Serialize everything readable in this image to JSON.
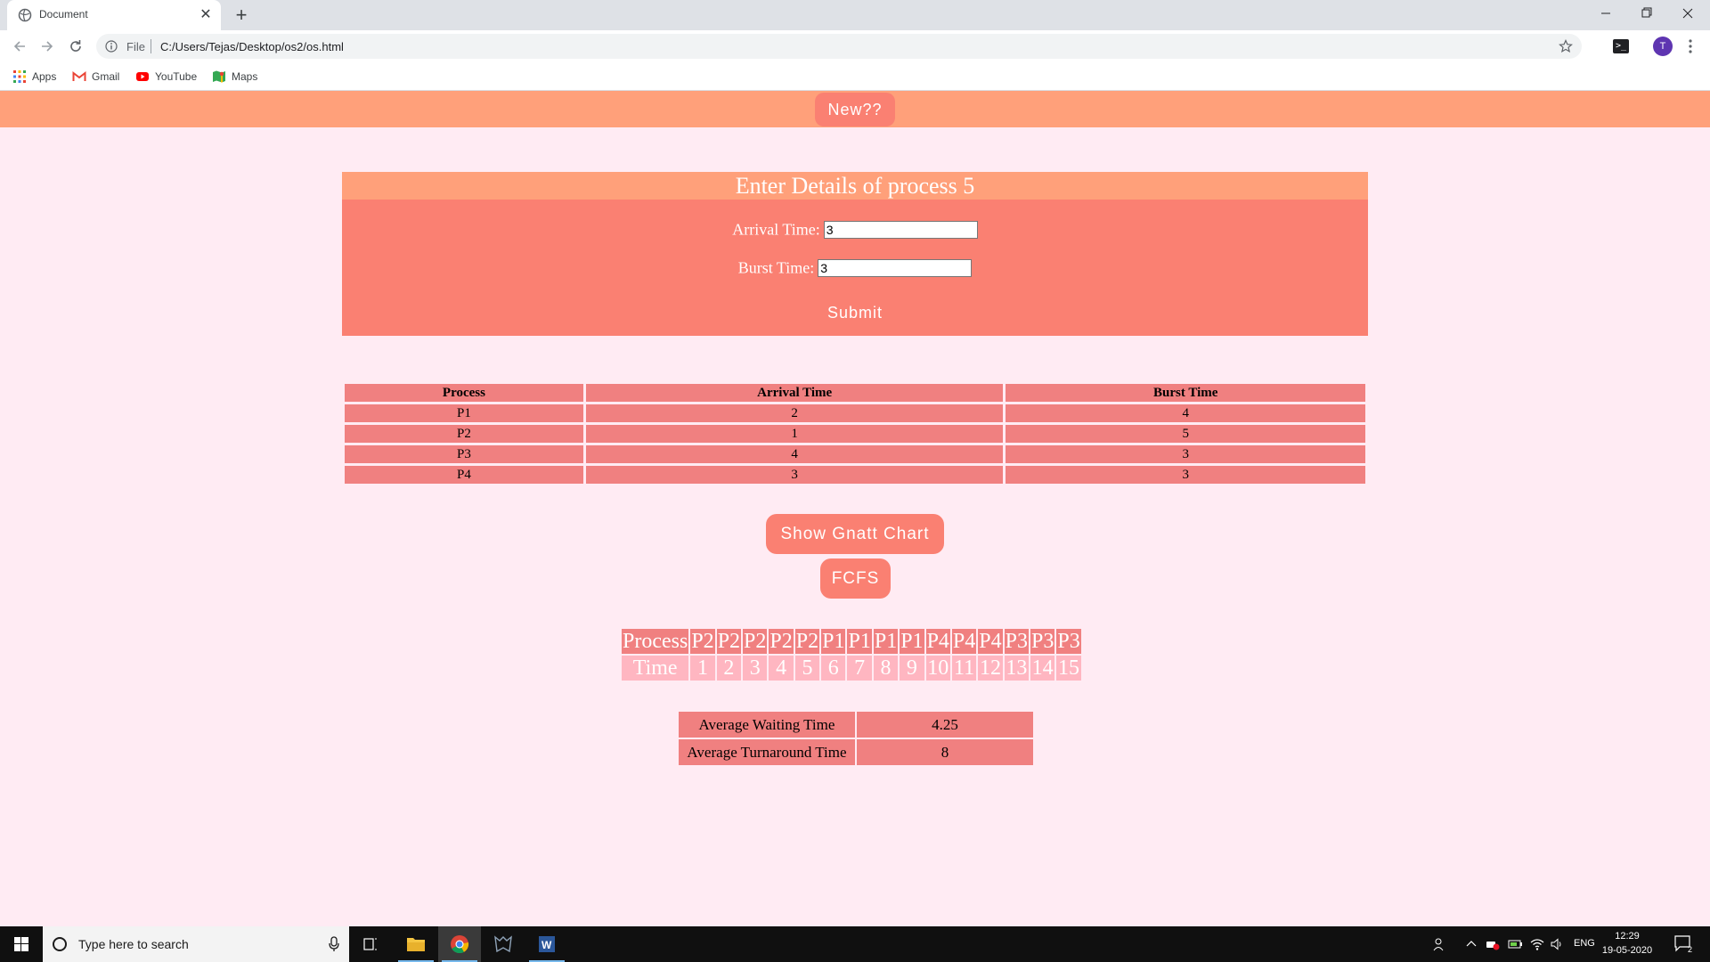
{
  "browser": {
    "tab_title": "Document",
    "tab_close": "✕",
    "new_tab": "+",
    "url_scheme": "File",
    "url": "C:/Users/Tejas/Desktop/os2/os.html",
    "avatar_letter": "T",
    "extension_glyph": ">_",
    "bookmarks": [
      "Apps",
      "Gmail",
      "YouTube",
      "Maps"
    ]
  },
  "page": {
    "new_button": "New??",
    "form": {
      "title": "Enter Details of process 5",
      "arrival_label": "Arrival Time:",
      "arrival_value": "3",
      "burst_label": "Burst Time:",
      "burst_value": "3",
      "submit": "Submit"
    },
    "process_table": {
      "headers": [
        "Process",
        "Arrival Time",
        "Burst Time"
      ],
      "rows": [
        [
          "P1",
          "2",
          "4"
        ],
        [
          "P2",
          "1",
          "5"
        ],
        [
          "P3",
          "4",
          "3"
        ],
        [
          "P4",
          "3",
          "3"
        ]
      ]
    },
    "gnatt_button": "Show Gnatt Chart",
    "fcfs_button": "FCFS",
    "gantt": {
      "process_label": "Process",
      "time_label": "Time",
      "processes": [
        "P2",
        "P2",
        "P2",
        "P2",
        "P2",
        "P1",
        "P1",
        "P1",
        "P1",
        "P4",
        "P4",
        "P4",
        "P3",
        "P3",
        "P3"
      ],
      "times": [
        "1",
        "2",
        "3",
        "4",
        "5",
        "6",
        "7",
        "8",
        "9",
        "10",
        "11",
        "12",
        "13",
        "14",
        "15"
      ]
    },
    "averages": [
      {
        "label": "Average Waiting Time",
        "value": "4.25"
      },
      {
        "label": "Average Turnaround Time",
        "value": "8"
      }
    ]
  },
  "taskbar": {
    "search_placeholder": "Type here to search",
    "language": "ENG",
    "time": "12:29",
    "date": "19-05-2020",
    "notification_count": "2"
  },
  "colors": {
    "page_bg": "#ffebf3",
    "accent": "#ffa07a",
    "button": "#fa8072",
    "cell": "#f08080",
    "time_cell": "#ffb6c1"
  }
}
